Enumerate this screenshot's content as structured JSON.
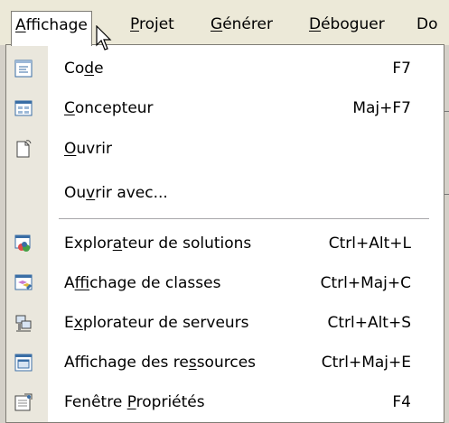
{
  "menubar": {
    "items": [
      {
        "pre": "",
        "acc": "A",
        "post": "ffichage"
      },
      {
        "pre": "",
        "acc": "P",
        "post": "rojet"
      },
      {
        "pre": "",
        "acc": "G",
        "post": "énérer"
      },
      {
        "pre": "",
        "acc": "D",
        "post": "éboguer"
      },
      {
        "pre": "Do",
        "acc": "",
        "post": ""
      }
    ]
  },
  "menu": {
    "items": [
      {
        "icon": "code-icon",
        "pre": "Co",
        "acc": "d",
        "post": "e",
        "shortcut": "F7"
      },
      {
        "icon": "designer-icon",
        "pre": "",
        "acc": "C",
        "post": "oncepteur",
        "shortcut": "Maj+F7"
      },
      {
        "icon": "open-document-icon",
        "pre": "",
        "acc": "O",
        "post": "uvrir",
        "shortcut": ""
      },
      {
        "icon": "",
        "pre": "Ou",
        "acc": "v",
        "post": "rir avec...",
        "shortcut": ""
      },
      {
        "icon": "solution-explorer-icon",
        "pre": "Explor",
        "acc": "a",
        "post": "teur de solutions",
        "shortcut": "Ctrl+Alt+L"
      },
      {
        "icon": "class-view-icon",
        "pre": "A",
        "acc": "f",
        "post": "fichage de classes",
        "shortcut": "Ctrl+Maj+C"
      },
      {
        "icon": "server-explorer-icon",
        "pre": "E",
        "acc": "x",
        "post": "plorateur de serveurs",
        "shortcut": "Ctrl+Alt+S"
      },
      {
        "icon": "resource-view-icon",
        "pre": "Affichage des re",
        "acc": "s",
        "post": "sources",
        "shortcut": "Ctrl+Maj+E"
      },
      {
        "icon": "properties-window-icon",
        "pre": "Fenêtre ",
        "acc": "P",
        "post": "ropriétés",
        "shortcut": "F4"
      }
    ]
  }
}
